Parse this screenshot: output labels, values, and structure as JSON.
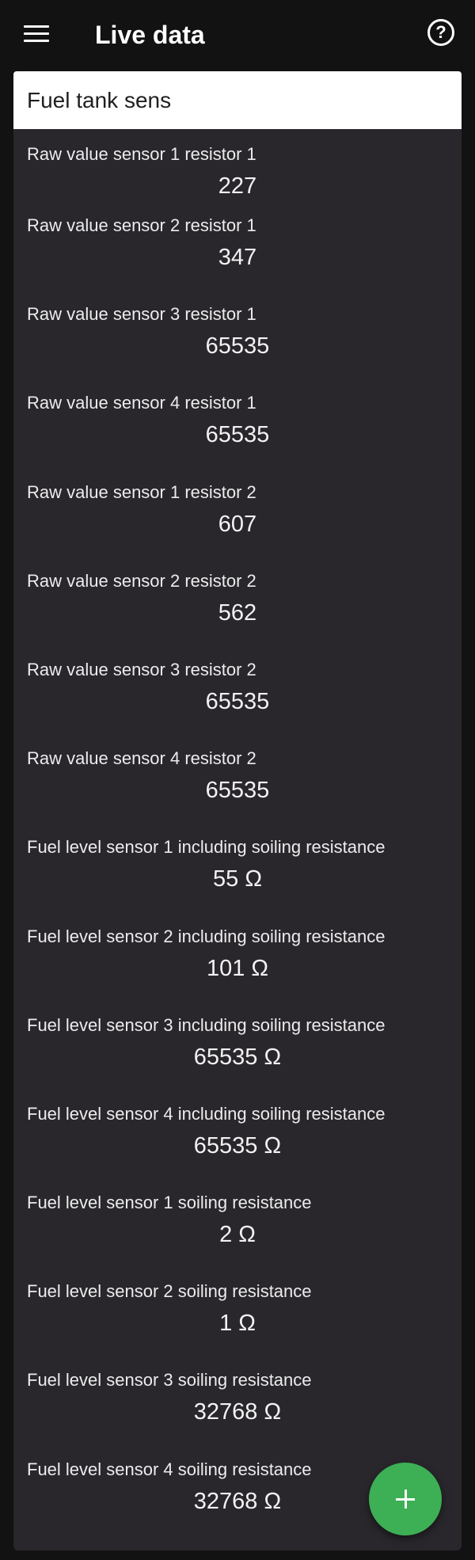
{
  "header": {
    "title": "Live data",
    "menu_icon": "hamburger-menu-icon",
    "help_icon": "help-circle-icon",
    "help_glyph": "?"
  },
  "search": {
    "value": "Fuel tank sens"
  },
  "readings": [
    {
      "label": "Raw value sensor 1 resistor 1",
      "value": "227"
    },
    {
      "label": "Raw value sensor 2 resistor 1",
      "value": "347"
    },
    {
      "label": "Raw value sensor 3 resistor 1",
      "value": "65535"
    },
    {
      "label": "Raw value sensor 4 resistor 1",
      "value": "65535"
    },
    {
      "label": "Raw value sensor 1 resistor 2",
      "value": "607"
    },
    {
      "label": "Raw value sensor 2 resistor 2",
      "value": "562"
    },
    {
      "label": "Raw value sensor 3 resistor 2",
      "value": "65535"
    },
    {
      "label": "Raw value sensor 4 resistor 2",
      "value": "65535"
    },
    {
      "label": "Fuel level sensor 1 including soiling resistance",
      "value": "55 Ω"
    },
    {
      "label": "Fuel level sensor 2 including soiling resistance",
      "value": "101 Ω"
    },
    {
      "label": "Fuel level sensor 3 including soiling resistance",
      "value": "65535 Ω"
    },
    {
      "label": "Fuel level sensor 4 including soiling resistance",
      "value": "65535 Ω"
    },
    {
      "label": "Fuel level sensor 1 soiling resistance",
      "value": "2 Ω"
    },
    {
      "label": "Fuel level sensor 2 soiling resistance",
      "value": "1 Ω"
    },
    {
      "label": "Fuel level sensor 3 soiling resistance",
      "value": "32768 Ω"
    },
    {
      "label": "Fuel level sensor 4 soiling resistance",
      "value": "32768 Ω"
    }
  ],
  "fab": {
    "icon": "plus-icon",
    "color": "#3daf55"
  }
}
